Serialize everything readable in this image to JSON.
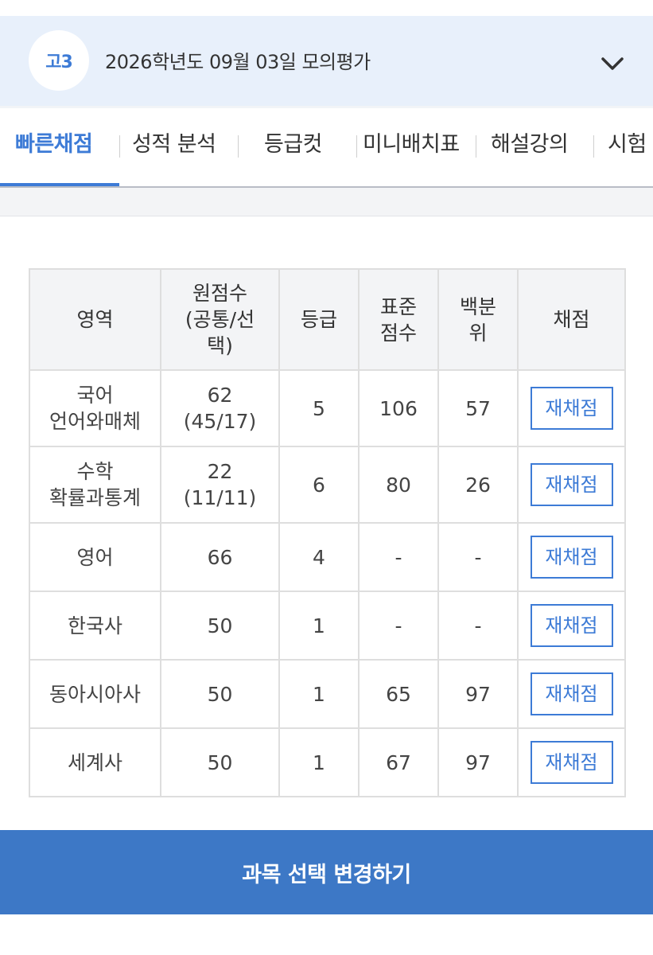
{
  "header": {
    "grade_badge": "고3",
    "exam_title": "2026학년도 09월 03일 모의평가",
    "expand_icon": "chevron-down-icon"
  },
  "tabs": [
    {
      "label": "빠른채점",
      "active": true
    },
    {
      "label": "성적 분석",
      "active": false
    },
    {
      "label": "등급컷",
      "active": false
    },
    {
      "label": "미니배치표",
      "active": false
    },
    {
      "label": "해설강의",
      "active": false
    },
    {
      "label": "시험",
      "active": false
    }
  ],
  "table": {
    "headers": {
      "area": "영역",
      "raw_line1": "원점수",
      "raw_line2": "(공통/선",
      "raw_line3": "택)",
      "grade": "등급",
      "std_line1": "표준",
      "std_line2": "점수",
      "pct_line1": "백분",
      "pct_line2": "위",
      "scoring": "채점"
    },
    "rows": [
      {
        "subject_line1": "국어",
        "subject_line2": "언어와매체",
        "raw_line1": "62",
        "raw_line2": "(45/17)",
        "grade": "5",
        "standard": "106",
        "percentile": "57",
        "button": "재채점"
      },
      {
        "subject_line1": "수학",
        "subject_line2": "확률과통계",
        "raw_line1": "22",
        "raw_line2": "(11/11)",
        "grade": "6",
        "standard": "80",
        "percentile": "26",
        "button": "재채점"
      },
      {
        "subject_line1": "영어",
        "subject_line2": "",
        "raw_line1": "66",
        "raw_line2": "",
        "grade": "4",
        "standard": "-",
        "percentile": "-",
        "button": "재채점"
      },
      {
        "subject_line1": "한국사",
        "subject_line2": "",
        "raw_line1": "50",
        "raw_line2": "",
        "grade": "1",
        "standard": "-",
        "percentile": "-",
        "button": "재채점"
      },
      {
        "subject_line1": "동아시아사",
        "subject_line2": "",
        "raw_line1": "50",
        "raw_line2": "",
        "grade": "1",
        "standard": "65",
        "percentile": "97",
        "button": "재채점"
      },
      {
        "subject_line1": "세계사",
        "subject_line2": "",
        "raw_line1": "50",
        "raw_line2": "",
        "grade": "1",
        "standard": "67",
        "percentile": "97",
        "button": "재채점"
      }
    ]
  },
  "cta": {
    "label": "과목 선택 변경하기"
  },
  "colors": {
    "accent": "#3d7bd6",
    "cta_bg": "#3d78c6",
    "header_bg": "#e8f0fb"
  }
}
